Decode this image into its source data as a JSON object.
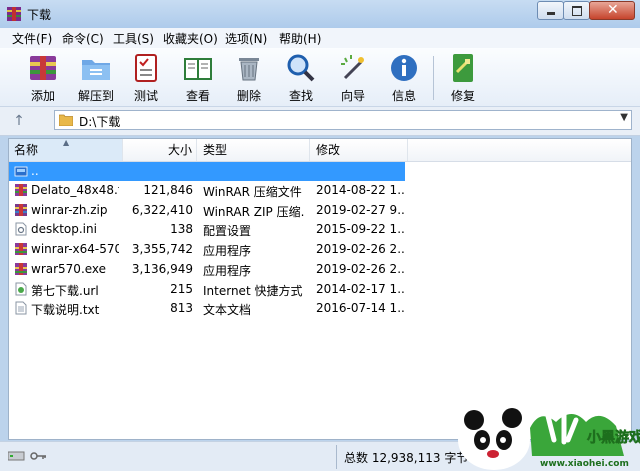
{
  "window": {
    "title": "下载"
  },
  "menu": [
    "文件(F)",
    "命令(C)",
    "工具(S)",
    "收藏夹(O)",
    "选项(N)",
    "帮助(H)"
  ],
  "toolbar": {
    "add": "添加",
    "extract": "解压到",
    "test": "测试",
    "view": "查看",
    "delete": "删除",
    "find": "查找",
    "wizard": "向导",
    "info": "信息",
    "repair": "修复"
  },
  "address": {
    "path": "D:\\下载"
  },
  "columns": {
    "name": "名称",
    "size": "大小",
    "type": "类型",
    "modified": "修改"
  },
  "files": [
    {
      "name": "..",
      "size": "",
      "type": "",
      "modified": "",
      "icon": "parent-folder-icon"
    },
    {
      "name": "Delato_48x48.t...",
      "size": "121,846",
      "type": "WinRAR 压缩文件",
      "modified": "2014-08-22 1...",
      "icon": "rar-archive-icon"
    },
    {
      "name": "winrar-zh.zip",
      "size": "6,322,410",
      "type": "WinRAR ZIP 压缩...",
      "modified": "2019-02-27 9...",
      "icon": "zip-archive-icon"
    },
    {
      "name": "desktop.ini",
      "size": "138",
      "type": "配置设置",
      "modified": "2015-09-22 1...",
      "icon": "ini-file-icon"
    },
    {
      "name": "winrar-x64-570...",
      "size": "3,355,742",
      "type": "应用程序",
      "modified": "2019-02-26 2...",
      "icon": "exe-icon"
    },
    {
      "name": "wrar570.exe",
      "size": "3,136,949",
      "type": "应用程序",
      "modified": "2019-02-26 2...",
      "icon": "exe-icon"
    },
    {
      "name": "第七下载.url",
      "size": "215",
      "type": "Internet 快捷方式",
      "modified": "2014-02-17 1...",
      "icon": "url-shortcut-icon"
    },
    {
      "name": "下载说明.txt",
      "size": "813",
      "type": "文本文档",
      "modified": "2016-07-14 1...",
      "icon": "text-file-icon"
    }
  ],
  "status": {
    "total": "总数 12,938,113 字节"
  },
  "watermark": {
    "text": "小黑游戏",
    "url": "www.xiaohei.com"
  },
  "colors": {
    "selection": "#3399ff",
    "title_bar": "#bcd3ec",
    "close_button": "#c6442c"
  }
}
